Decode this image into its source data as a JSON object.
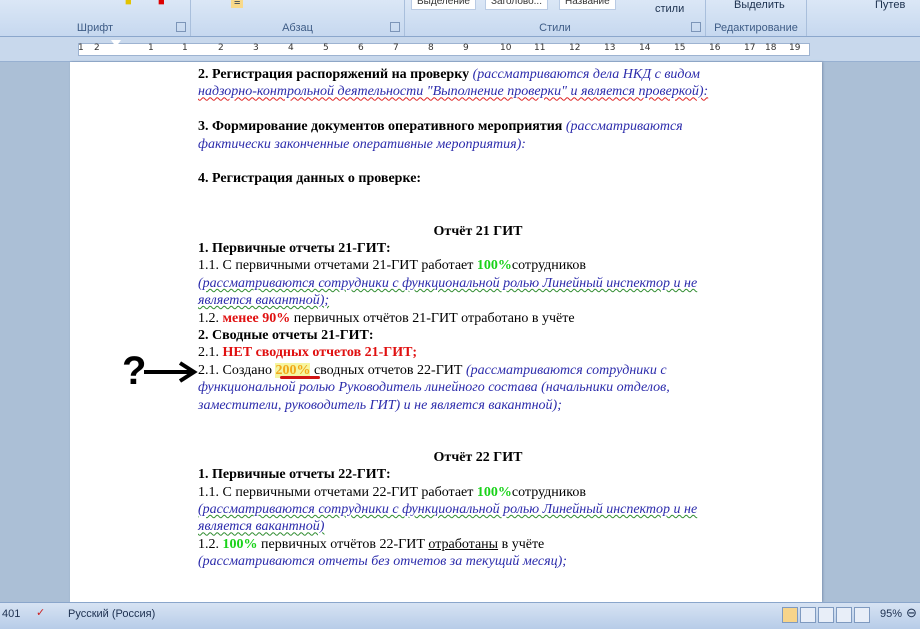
{
  "ribbon": {
    "groups": {
      "font": "Шрифт",
      "paragraph": "Абзац",
      "styles": "Стили",
      "editing": "Редактирование"
    },
    "style_items": [
      "Выделение",
      "Заголово...",
      "Название"
    ],
    "change_styles": "стили",
    "select": "Выделить",
    "extra": "Путев"
  },
  "ruler": {
    "numbers": [
      "1",
      "2",
      "1",
      "1",
      "2",
      "3",
      "4",
      "5",
      "6",
      "7",
      "8",
      "9",
      "10",
      "11",
      "12",
      "13",
      "14",
      "15",
      "16",
      "17",
      "18",
      "19"
    ]
  },
  "document": {
    "l1": "2. Регистрация распоряжений на проверку",
    "l1i": " (рассматриваются дела НКД с видом",
    "l2i": "надзорно-контрольной деятельности \"Выполнение проверки\" и является проверкой):",
    "l3": "3. Формирование документов оперативного мероприятия",
    "l3i": " (рассматриваются",
    "l4i": "фактически законченные оперативные мероприятия):",
    "l5": "4. Регистрация данных о проверке:",
    "h21": "Отчёт 21 ГИТ",
    "s21_1": "1. Первичные отчеты 21-ГИТ:",
    "s21_11a": "1.1. С первичными отчетами 21-ГИТ работает ",
    "s21_11b": "100%",
    "s21_11c": "сотрудников",
    "s21_11i1": "(рассматриваются сотрудники с функциональной ролью Линейный инспектор и не",
    "s21_11i2": "является вакантной);",
    "s21_12a": "1.2. ",
    "s21_12b": "менее 90%",
    "s21_12c": " первичных отчётов 21-ГИТ отработано в учёте",
    "s21_2": "2. Сводные отчеты 21-ГИТ:",
    "s21_21a": "2.1. ",
    "s21_21b": "НЕТ сводных отчетов 21-ГИТ;",
    "s21_22a": "2.1. Создано ",
    "s21_22b": "200%",
    "s21_22c": " сводных отчетов 22-ГИТ ",
    "s21_22i": "(рассматриваются сотрудники с",
    "s21_22i2": "функциональной ролью Руководитель линейного состава (начальники отделов,",
    "s21_22i3": "заместители, руководитель ГИТ) и не является вакантной);",
    "h22": "Отчёт 22 ГИТ",
    "s22_1": "1. Первичные отчеты 22-ГИТ:",
    "s22_11a": "1.1. С первичными отчетами 22-ГИТ работает  ",
    "s22_11b": "100%",
    "s22_11c": "сотрудников",
    "s22_11i1": "(рассматриваются сотрудники с функциональной ролью Линейный инспектор и не",
    "s22_11i2": "является вакантной)",
    "s22_12a": "1.2. ",
    "s22_12b": "100%",
    "s22_12c": " первичных отчётов 22-ГИТ ",
    "s22_12d": "отработаны",
    "s22_12e": " в учёте",
    "s22_12i": "(рассматриваются отчеты без отчетов за текущий месяц);"
  },
  "annotation": {
    "mark": "?"
  },
  "status": {
    "words": "401",
    "language": "Русский (Россия)",
    "zoom": "95%"
  }
}
